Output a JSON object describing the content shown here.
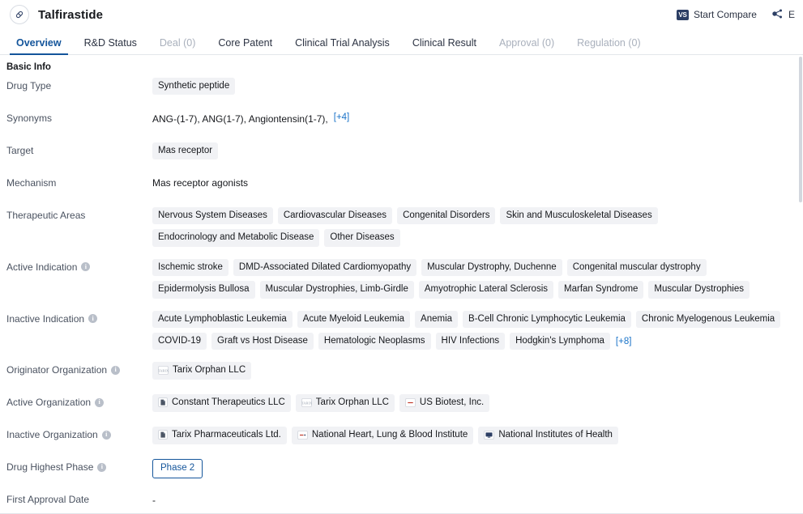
{
  "header": {
    "drug_name": "Talfirastide",
    "drug_icon": "capsule-icon",
    "actions": [
      {
        "icon": "vs-badge-icon",
        "label": "Start Compare"
      },
      {
        "icon": "network-share-icon",
        "label": "E"
      }
    ]
  },
  "tabs": [
    {
      "label": "Overview",
      "state": "active"
    },
    {
      "label": "R&D Status",
      "state": "normal"
    },
    {
      "label": "Deal (0)",
      "state": "disabled"
    },
    {
      "label": "Core Patent",
      "state": "normal"
    },
    {
      "label": "Clinical Trial Analysis",
      "state": "normal"
    },
    {
      "label": "Clinical Result",
      "state": "normal"
    },
    {
      "label": "Approval (0)",
      "state": "disabled"
    },
    {
      "label": "Regulation (0)",
      "state": "disabled"
    }
  ],
  "section": {
    "title": "Basic Info"
  },
  "fields": {
    "drug_type": {
      "label": "Drug Type",
      "tags": [
        "Synthetic peptide"
      ]
    },
    "synonyms": {
      "label": "Synonyms",
      "text": "ANG-(1-7),  ANG(1-7),  Angiontensin(1-7),",
      "more": "[+4]"
    },
    "target": {
      "label": "Target",
      "tags": [
        "Mas receptor"
      ]
    },
    "mechanism": {
      "label": "Mechanism",
      "text": "Mas receptor agonists"
    },
    "therapeutic_areas": {
      "label": "Therapeutic Areas",
      "tags": [
        "Nervous System Diseases",
        "Cardiovascular Diseases",
        "Congenital Disorders",
        "Skin and Musculoskeletal Diseases",
        "Endocrinology and Metabolic Disease",
        "Other Diseases"
      ]
    },
    "active_indication": {
      "label": "Active Indication",
      "has_info": true,
      "tags": [
        "Ischemic stroke",
        "DMD-Associated Dilated Cardiomyopathy",
        "Muscular Dystrophy, Duchenne",
        "Congenital muscular dystrophy",
        "Epidermolysis Bullosa",
        "Muscular Dystrophies, Limb-Girdle",
        "Amyotrophic Lateral Sclerosis",
        "Marfan Syndrome",
        "Muscular Dystrophies"
      ]
    },
    "inactive_indication": {
      "label": "Inactive Indication",
      "has_info": true,
      "tags": [
        "Acute Lymphoblastic Leukemia",
        "Acute Myeloid Leukemia",
        "Anemia",
        "B-Cell Chronic Lymphocytic Leukemia",
        "Chronic Myelogenous Leukemia",
        "COVID-19",
        "Graft vs Host Disease",
        "Hematologic Neoplasms",
        "HIV Infections",
        "Hodgkin's Lymphoma"
      ],
      "more": "[+8]"
    },
    "originator_organization": {
      "label": "Originator Organization",
      "has_info": true,
      "orgs": [
        {
          "name": "Tarix Orphan LLC",
          "icon": "company-logo-icon"
        }
      ]
    },
    "active_organization": {
      "label": "Active Organization",
      "has_info": true,
      "orgs": [
        {
          "name": "Constant Therapeutics LLC",
          "icon": "document-logo-icon"
        },
        {
          "name": "Tarix Orphan LLC",
          "icon": "company-logo-icon"
        },
        {
          "name": "US Biotest, Inc.",
          "icon": "red-dash-logo-icon"
        }
      ]
    },
    "inactive_organization": {
      "label": "Inactive Organization",
      "has_info": true,
      "orgs": [
        {
          "name": "Tarix Pharmaceuticals Ltd.",
          "icon": "document-logo-icon"
        },
        {
          "name": "National Heart, Lung & Blood Institute",
          "icon": "red-dash-logo-icon"
        },
        {
          "name": "National Institutes of Health",
          "icon": "monitor-logo-icon"
        }
      ]
    },
    "drug_highest_phase": {
      "label": "Drug Highest Phase",
      "has_info": true,
      "value": "Phase 2"
    },
    "first_approval_date": {
      "label": "First Approval Date",
      "value": "-"
    }
  },
  "colors": {
    "accent": "#14559b",
    "tag_bg": "#f1f2f5",
    "link": "#1a73c8",
    "label": "#4a5260"
  }
}
